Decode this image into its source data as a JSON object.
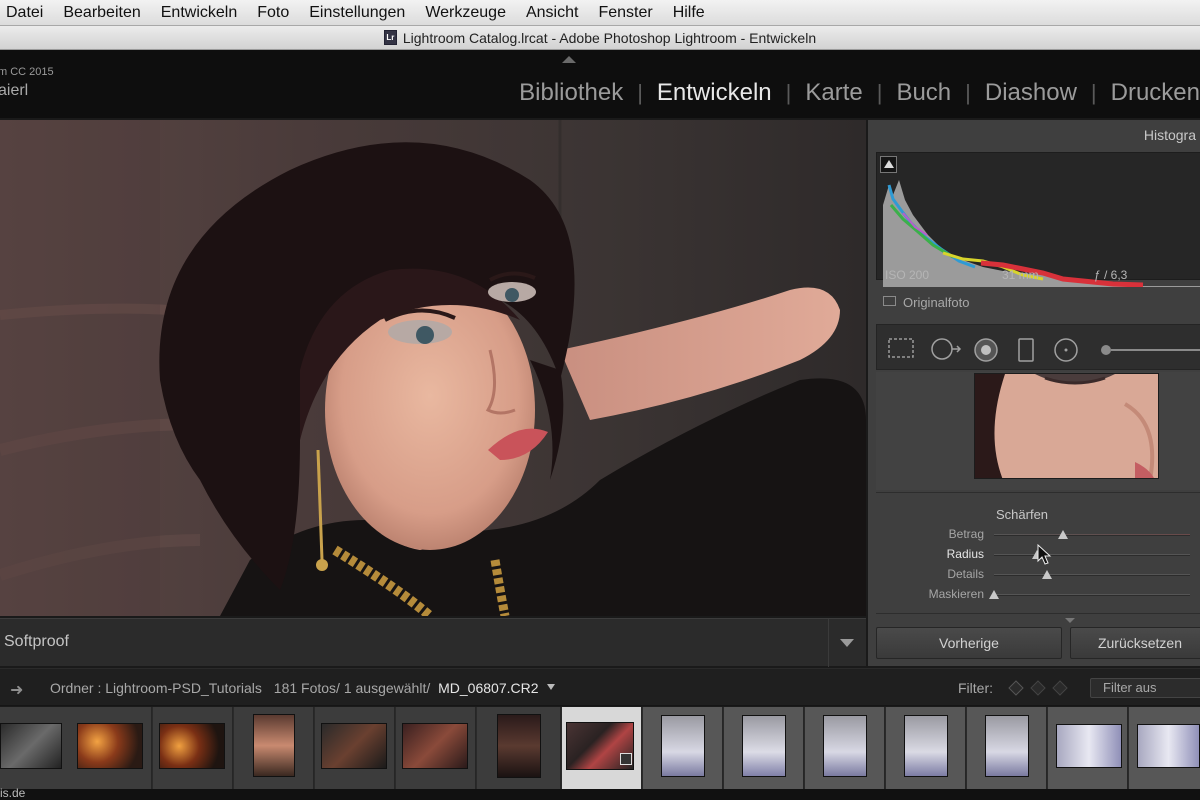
{
  "menubar": {
    "items": [
      "Datei",
      "Bearbeiten",
      "Entwickeln",
      "Foto",
      "Einstellungen",
      "Werkzeuge",
      "Ansicht",
      "Fenster",
      "Hilfe"
    ]
  },
  "titlebar": {
    "title": "Lightroom Catalog.lrcat - Adobe Photoshop Lightroom - Entwickeln",
    "icon_text": "Lr"
  },
  "identity": {
    "line1": "m CC 2015",
    "line2": "aierl"
  },
  "modules": {
    "items": [
      "Bibliothek",
      "Entwickeln",
      "Karte",
      "Buch",
      "Diashow",
      "Drucken"
    ],
    "active": "Entwickeln"
  },
  "toolbar": {
    "softproof_label": "Softproof"
  },
  "histogram": {
    "title": "Histogra",
    "iso": "ISO 200",
    "focal": "31 mm",
    "aperture": "ƒ / 6,3",
    "original_label": "Originalfoto"
  },
  "sharpen": {
    "title": "Schärfen",
    "sliders": [
      {
        "label": "Betrag",
        "value": 0.35,
        "highlight": false
      },
      {
        "label": "Radius",
        "value": 0.22,
        "highlight": true
      },
      {
        "label": "Details",
        "value": 0.27,
        "highlight": false
      },
      {
        "label": "Maskieren",
        "value": 0.0,
        "highlight": false
      }
    ]
  },
  "buttons": {
    "previous": "Vorherige",
    "reset": "Zurücksetzen"
  },
  "filmstrip_header": {
    "source": "Ordner : Lightroom-PSD_Tutorials",
    "count": "181 Fotos/ 1 ausgewählt/",
    "filename": "MD_06807.CR2",
    "filter_label": "Filter:",
    "filter_value": "Filter aus"
  },
  "bottom_text": "is.de",
  "colors": {
    "accent_active_module": "#e8e8e8",
    "panel": "#3f3f3f",
    "filmstrip_selected": "#d8d8d8"
  }
}
